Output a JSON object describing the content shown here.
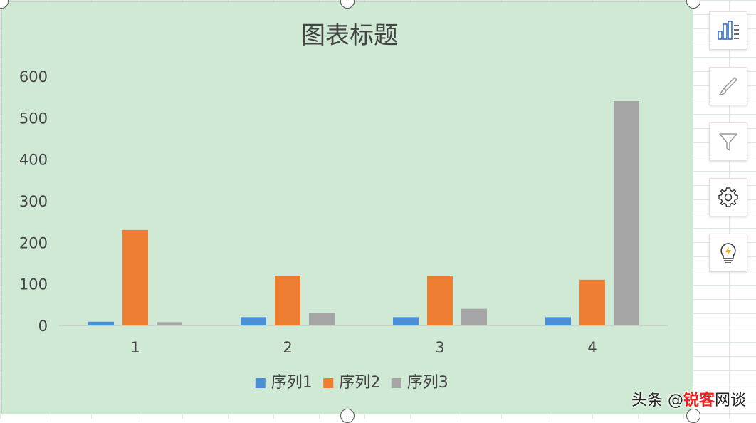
{
  "chart_data": {
    "type": "bar",
    "title": "图表标题",
    "categories": [
      "1",
      "2",
      "3",
      "4"
    ],
    "series": [
      {
        "name": "序列1",
        "color": "#4a90d9",
        "values": [
          9,
          20,
          20,
          20
        ]
      },
      {
        "name": "序列2",
        "color": "#ed7d31",
        "values": [
          230,
          120,
          120,
          110
        ]
      },
      {
        "name": "序列3",
        "color": "#a5a5a5",
        "values": [
          8,
          30,
          40,
          540
        ]
      }
    ],
    "ylim": [
      0,
      600
    ],
    "yticks": [
      "0",
      "100",
      "200",
      "300",
      "400",
      "500",
      "600"
    ],
    "grid": false,
    "legend": "bottom"
  },
  "toolbar": {
    "buttons": [
      {
        "icon": "chart-elements-icon"
      },
      {
        "icon": "brush-icon"
      },
      {
        "icon": "filter-icon"
      },
      {
        "icon": "gear-icon"
      },
      {
        "icon": "lightbulb-icon"
      }
    ]
  },
  "watermark": {
    "prefix": "头条 @",
    "brand": "锐客",
    "suffix": "网谈"
  }
}
